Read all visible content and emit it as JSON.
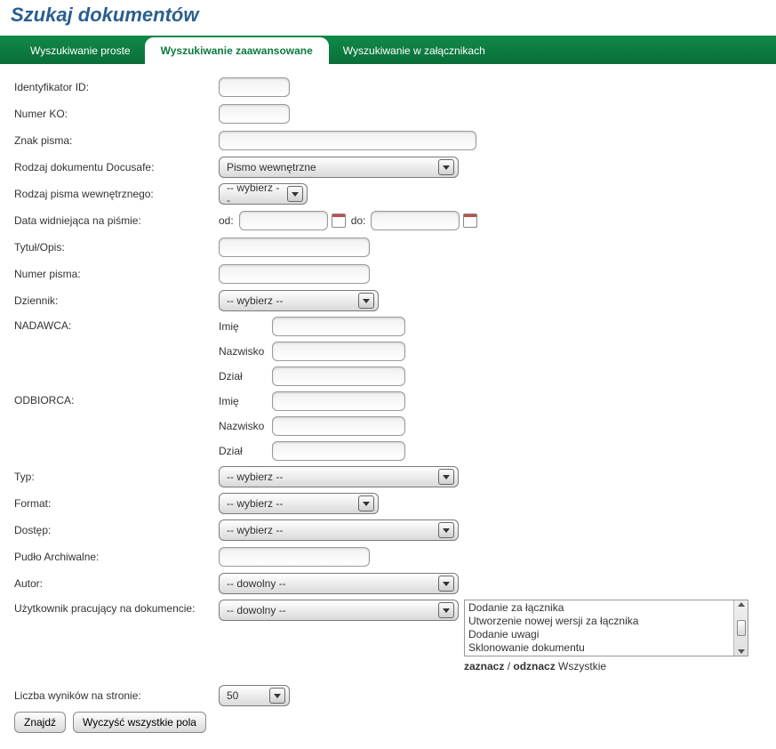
{
  "title": "Szukaj dokumentów",
  "tabs": [
    {
      "label": "Wyszukiwanie proste",
      "active": false
    },
    {
      "label": "Wyszukiwanie zaawansowane",
      "active": true
    },
    {
      "label": "Wyszukiwanie w załącznikach",
      "active": false
    }
  ],
  "labels": {
    "id": "Identyfikator ID:",
    "numerKO": "Numer KO:",
    "znakPisma": "Znak pisma:",
    "rodzajDoc": "Rodzaj dokumentu Docusafe:",
    "rodzajPismaWew": "Rodzaj pisma wewnętrznego:",
    "dataWidniejaca": "Data widniejąca na piśmie:",
    "od": "od:",
    "do": "do:",
    "tytulOpis": "Tytuł/Opis:",
    "numerPisma": "Numer pisma:",
    "dziennik": "Dziennik:",
    "nadawca": "NADAWCA:",
    "odbiorca": "ODBIORCA:",
    "imie": "Imię",
    "nazwisko": "Nazwisko",
    "dzial": "Dział",
    "typ": "Typ:",
    "format": "Format:",
    "dostep": "Dostęp:",
    "pudlo": "Pudło Archiwalne:",
    "autor": "Autor:",
    "uzytkownik": "Użytkownik pracujący na dokumencie:",
    "liczbaWynikow": "Liczba wyników na stronie:"
  },
  "selects": {
    "rodzajDoc": "Pismo wewnętrzne",
    "rodzajPismaWew": "-- wybierz --",
    "dziennik": "-- wybierz --",
    "typ": "-- wybierz --",
    "format": "-- wybierz --",
    "dostep": "-- wybierz --",
    "autor": "-- dowolny --",
    "uzytkownik": "-- dowolny --",
    "liczbaWynikow": "50"
  },
  "listbox": {
    "items": [
      "Dodanie za łącznika",
      "Utworzenie nowej wersji za łącznika",
      "Dodanie uwagi",
      "Sklonowanie dokumentu"
    ]
  },
  "zaznacz": {
    "zaznacz": "zaznacz",
    "sep": " / ",
    "odznacz": "odznacz",
    "wszystkie": " Wszystkie"
  },
  "buttons": {
    "znajdz": "Znajdź",
    "wyczysc": "Wyczyść wszystkie pola"
  }
}
